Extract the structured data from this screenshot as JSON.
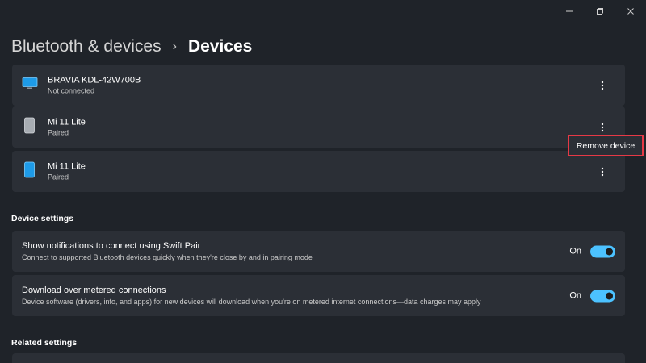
{
  "breadcrumb": {
    "parent": "Bluetooth & devices",
    "separator": "›",
    "current": "Devices"
  },
  "devices": [
    {
      "name": "BRAVIA KDL-42W700B",
      "status": "Not connected",
      "icon": "tv-icon"
    },
    {
      "name": "Mi 11 Lite",
      "status": "Paired",
      "icon": "phone-gray-icon"
    },
    {
      "name": "Mi 11 Lite",
      "status": "Paired",
      "icon": "phone-blue-icon"
    }
  ],
  "context_menu": {
    "remove_label": "Remove device"
  },
  "device_settings": {
    "title": "Device settings",
    "items": [
      {
        "title": "Show notifications to connect using Swift Pair",
        "description": "Connect to supported Bluetooth devices quickly when they're close by and in pairing mode",
        "toggle_label": "On",
        "enabled": true
      },
      {
        "title": "Download over metered connections",
        "description": "Device software (drivers, info, and apps) for new devices will download when you're on metered internet connections—data charges may apply",
        "toggle_label": "On",
        "enabled": true
      }
    ]
  },
  "related_settings": {
    "title": "Related settings"
  },
  "colors": {
    "background": "#1f2329",
    "card": "#2b2f36",
    "accent": "#4cc2ff",
    "highlight": "#e63946"
  }
}
